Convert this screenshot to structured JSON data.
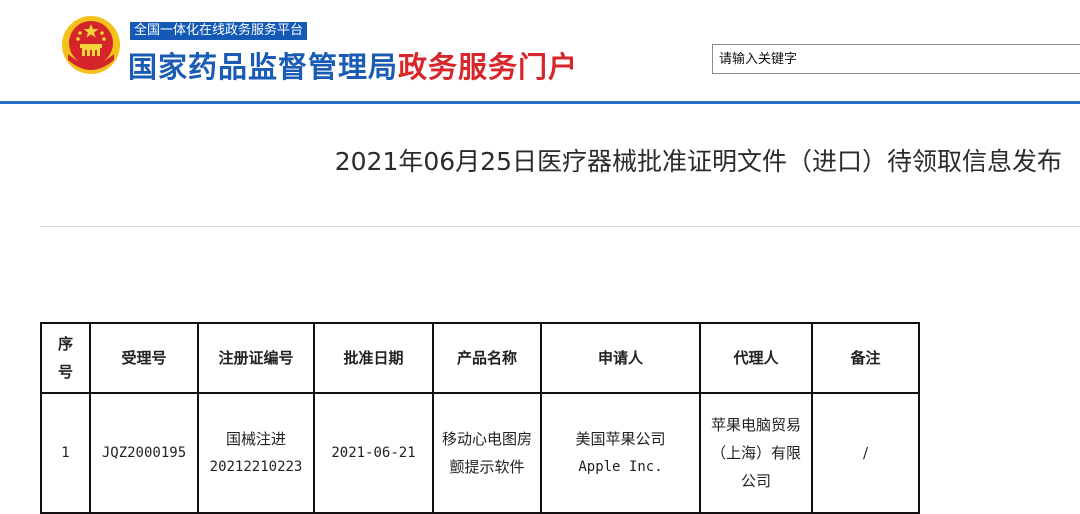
{
  "header": {
    "platform_tag": "全国一体化在线政务服务平台",
    "title_part1": "国家药品监督管理局",
    "title_part2": "政务服务门户",
    "search_placeholder": "请输入关键字",
    "emblem_icon": "national-emblem-icon",
    "colors": {
      "accent": "#1459b6",
      "title_red": "#d8262b",
      "rule": "#2c6fc8"
    }
  },
  "document": {
    "title": "2021年06月25日医疗器械批准证明文件（进口）待领取信息发布"
  },
  "table": {
    "headers": [
      "序号",
      "受理号",
      "注册证编号",
      "批准日期",
      "产品名称",
      "申请人",
      "代理人",
      "备注"
    ],
    "rows": [
      {
        "index": "1",
        "acceptance_no": "JQZ2000195",
        "cert_line1": "国械注进",
        "cert_line2": "20212210223",
        "approval_date": "2021-06-21",
        "product": "移动心电图房颤提示软件",
        "applicant_line1": "美国苹果公司",
        "applicant_line2": "Apple Inc.",
        "agent": "苹果电脑贸易（上海）有限公司",
        "remark": "/"
      }
    ]
  }
}
